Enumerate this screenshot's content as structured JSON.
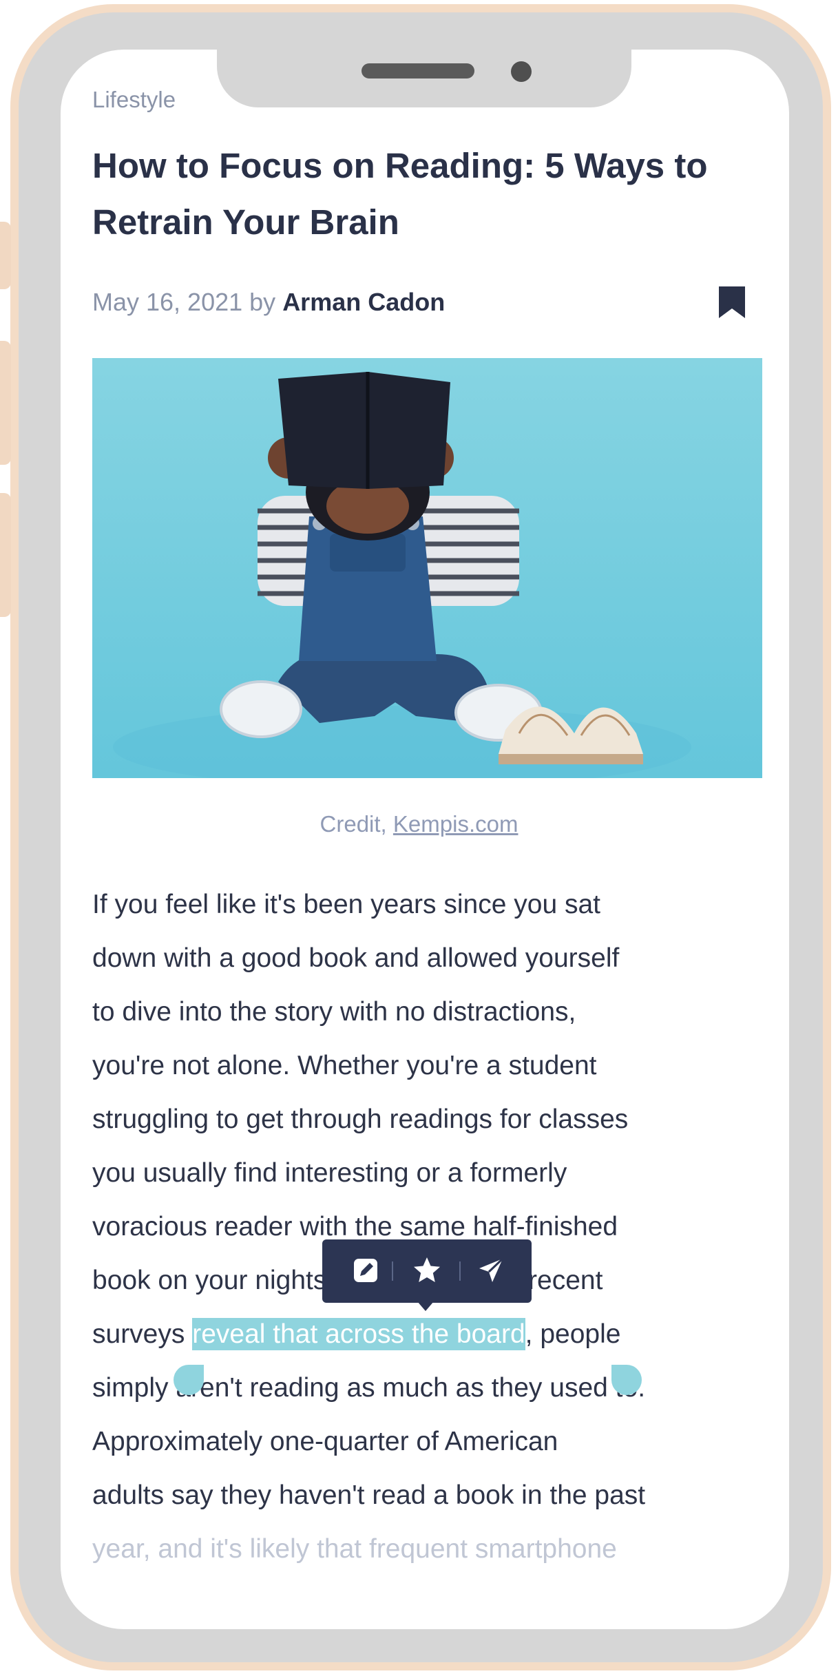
{
  "article": {
    "category": "Lifestyle",
    "title": "How to Focus on Reading: 5 Ways to Retrain Your Brain",
    "date_by": "May 16, 2021 by",
    "author": "Arman Cadon",
    "image_caption_prefix": "Credit,",
    "image_caption_link": "Kempis.com",
    "body_lines": [
      "If you feel like it's been years since you sat",
      "down with a good book and allowed yourself",
      "to dive into the story with no distractions,",
      "you're not alone. Whether you're a student",
      "struggling to get through readings for classes",
      "you usually find interesting or a formerly",
      "voracious reader with the same half-finished",
      "book on your nightstand for months, recent"
    ],
    "selected_line": {
      "before": "surveys",
      "highlight": "reveal that across the board",
      "after": ", people"
    },
    "body_lines_after": [
      "simply aren't reading as much as they used to.",
      "Approximately one-quarter of American",
      "adults say they haven't read a book in the past"
    ],
    "faded_line": "year, and it's likely that frequent smartphone"
  },
  "selection_toolbar": {
    "actions": [
      "edit-icon",
      "star-icon",
      "send-icon"
    ]
  },
  "colors": {
    "heading": "#2a3148",
    "muted": "#8a93a8",
    "highlight": "#8fd4de",
    "toolbar": "#2c3553",
    "image_bg": "#84d3e2",
    "phone_frame": "#f4dcc6"
  }
}
